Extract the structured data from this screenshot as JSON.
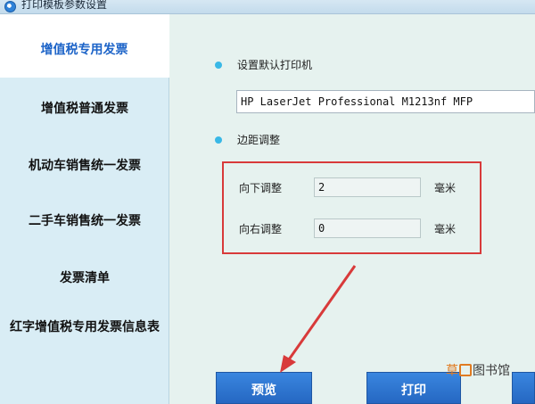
{
  "window": {
    "title": "打印模板参数设置",
    "icon": "app-icon"
  },
  "sidebar": {
    "items": [
      {
        "label": "增值税专用发票",
        "active": true
      },
      {
        "label": "增值税普通发票",
        "active": false
      },
      {
        "label": "机动车销售统一发票",
        "active": false
      },
      {
        "label": "二手车销售统一发票",
        "active": false
      },
      {
        "label": "发票清单",
        "active": false
      },
      {
        "label": "红字增值税专用发票信息表",
        "active": false
      }
    ]
  },
  "printer": {
    "label": "设置默认打印机",
    "value": "HP LaserJet Professional M1213nf MFP"
  },
  "margin": {
    "label": "边距调整",
    "down": {
      "label": "向下调整",
      "value": "2",
      "unit": "毫米"
    },
    "right": {
      "label": "向右调整",
      "value": "0",
      "unit": "毫米"
    }
  },
  "buttons": {
    "preview": "预览",
    "print": "打印"
  },
  "watermark": {
    "part1": "草",
    "part2": "图书馆"
  },
  "colors": {
    "accent": "#2567c2",
    "highlight_border": "#d83a3a",
    "annotation_arrow": "#d83a3a",
    "bullet": "#39b8e6"
  }
}
